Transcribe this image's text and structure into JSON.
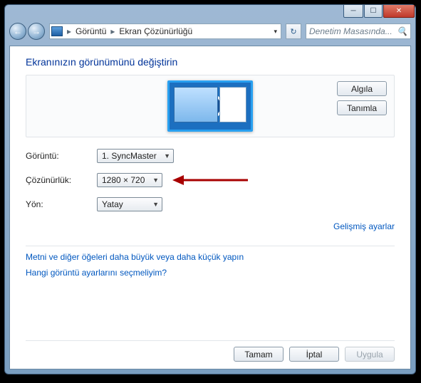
{
  "window": {
    "minimize_glyph": "─",
    "maximize_glyph": "☐",
    "close_glyph": "✕"
  },
  "nav": {
    "back_glyph": "←",
    "fwd_glyph": "→",
    "crumb1": "Görüntü",
    "crumb2": "Ekran Çözünürlüğü",
    "refresh_glyph": "↻",
    "search_glyph": "🔍"
  },
  "search": {
    "placeholder": "Denetim Masasında..."
  },
  "page": {
    "title": "Ekranınızın görünümünü değiştirin"
  },
  "monitor": {
    "number": "1"
  },
  "buttons": {
    "detect": "Algıla",
    "identify": "Tanımla",
    "ok": "Tamam",
    "cancel": "İptal",
    "apply": "Uygula"
  },
  "form": {
    "display_label": "Görüntü:",
    "display_value": "1. SyncMaster",
    "resolution_label": "Çözünürlük:",
    "resolution_value": "1280 × 720",
    "orientation_label": "Yön:",
    "orientation_value": "Yatay"
  },
  "links": {
    "advanced": "Gelişmiş ayarlar",
    "textsize": "Metni ve diğer öğeleri daha büyük veya daha küçük yapın",
    "whichsettings": "Hangi görüntü ayarlarını seçmeliyim?"
  }
}
